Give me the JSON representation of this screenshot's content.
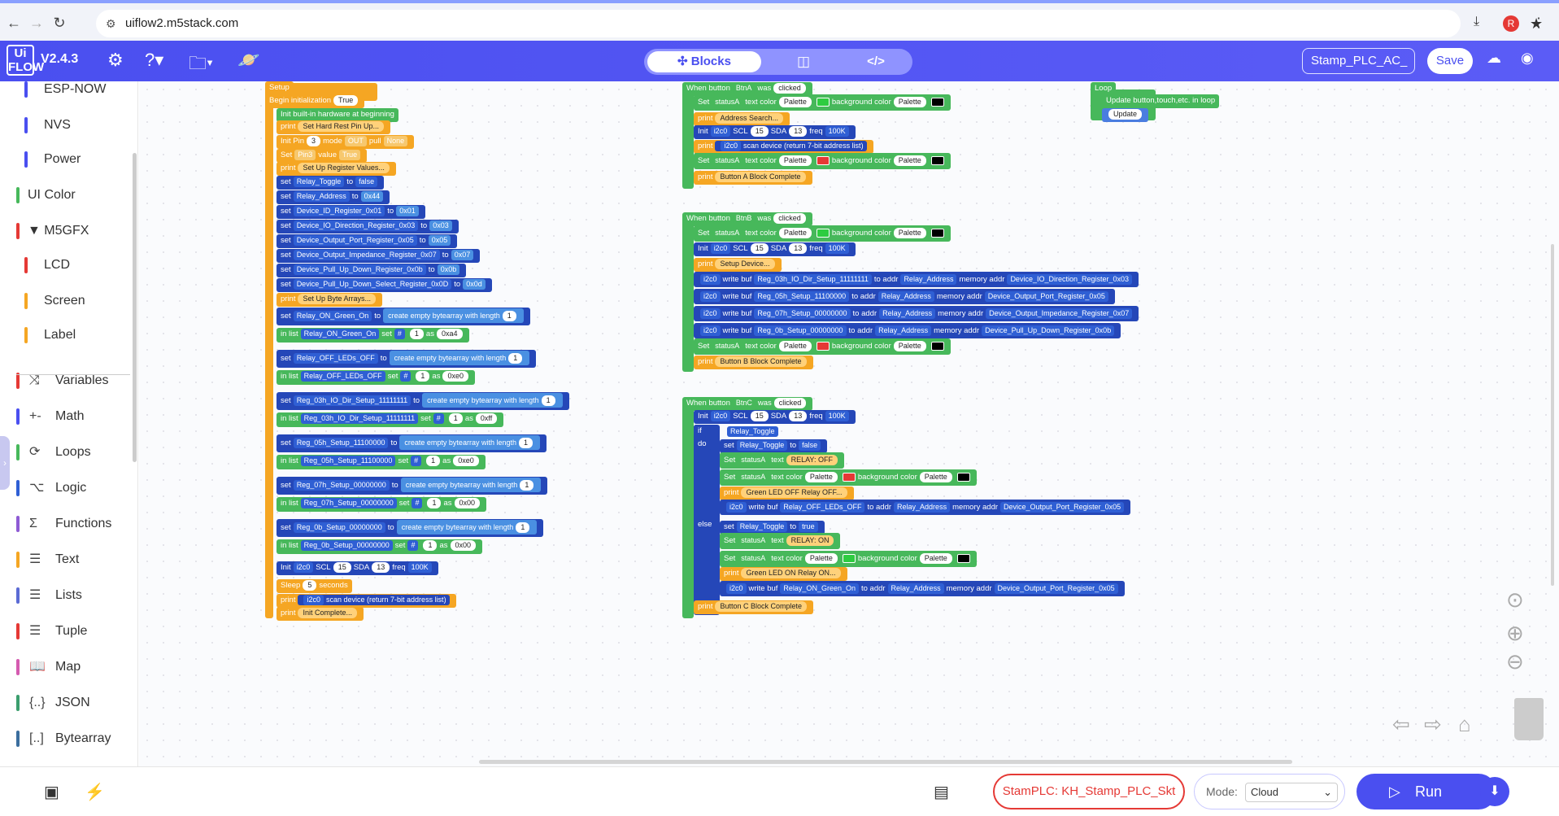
{
  "browser": {
    "url": "uiflow2.m5stack.com",
    "avatar": "R"
  },
  "app": {
    "logo": "Ui FLOW",
    "version": "V2.4.3",
    "tabs": {
      "blocks": "Blocks"
    },
    "project_name": "Stamp_PLC_AC_",
    "save": "Save"
  },
  "sidebar": [
    {
      "label": "ESP-NOW",
      "color": "#4a4ff0"
    },
    {
      "label": "NVS",
      "color": "#4a4ff0"
    },
    {
      "label": "Power",
      "color": "#4a4ff0"
    },
    {
      "label": "UI Color",
      "color": "#47b85b"
    },
    {
      "label": "▼ M5GFX",
      "color": "#e53935"
    },
    {
      "label": "LCD",
      "color": "#e53935"
    },
    {
      "label": "Screen",
      "color": "#f5a623"
    },
    {
      "label": "Label",
      "color": "#f5a623"
    },
    {
      "label": "Variables",
      "color": "#e53935",
      "icon": "⤨"
    },
    {
      "label": "Math",
      "color": "#4a4ff0",
      "icon": "+-"
    },
    {
      "label": "Loops",
      "color": "#47b85b",
      "icon": "⟳"
    },
    {
      "label": "Logic",
      "color": "#2f5fd4",
      "icon": "⌥"
    },
    {
      "label": "Functions",
      "color": "#8e5bd4",
      "icon": "Σ"
    },
    {
      "label": "Text",
      "color": "#f5a623",
      "icon": "☰"
    },
    {
      "label": "Lists",
      "color": "#5b6bd4",
      "icon": "☰"
    },
    {
      "label": "Tuple",
      "color": "#e53935",
      "icon": "☰"
    },
    {
      "label": "Map",
      "color": "#d45bb0",
      "icon": "📖"
    },
    {
      "label": "JSON",
      "color": "#3b9e6e",
      "icon": "{..}"
    },
    {
      "label": "Bytearray",
      "color": "#3b6e9e",
      "icon": "[..]"
    }
  ],
  "footer": {
    "device": "StamPLC: KH_Stamp_PLC_Skt",
    "mode_label": "Mode:",
    "mode_value": "Cloud",
    "run": "Run"
  },
  "blocks": {
    "setup": {
      "title": "Setup",
      "begin": "Begin initialization",
      "true": "True",
      "init_hw": "Init built-in hardware at beginning",
      "print": "print",
      "set": "set",
      "set_cap": "Set",
      "to": "to",
      "init": "Init",
      "in_list": "in list",
      "as": "as",
      "hash": "#",
      "one": "1",
      "create": "create empty bytearray with length",
      "p1": "Set Hard Rest Pin Up...",
      "pin": "Init Pin",
      "pin_num": "3",
      "mode": "mode",
      "mode_val": "OUT",
      "pull": "pull",
      "pull_val": "None",
      "set_pin": "Pin3",
      "value": "value",
      "true_val": "True",
      "p2": "Set Up Register Values...",
      "vars": [
        {
          "name": "Relay_Toggle",
          "val": "false",
          "kind": "bool"
        },
        {
          "name": "Relay_Address",
          "val": "0x44",
          "kind": "num"
        },
        {
          "name": "Device_ID_Register_0x01",
          "val": "0x01",
          "kind": "num"
        },
        {
          "name": "Device_IO_Direction_Register_0x03",
          "val": "0x03",
          "kind": "num"
        },
        {
          "name": "Device_Output_Port_Register_0x05",
          "val": "0x05",
          "kind": "num"
        },
        {
          "name": "Device_Output_Impedance_Register_0x07",
          "val": "0x07",
          "kind": "num"
        },
        {
          "name": "Device_Pull_Up_Down_Register_0x0b",
          "val": "0x0b",
          "kind": "num"
        },
        {
          "name": "Device_Pull_Up_Down_Select_Register_0x0D",
          "val": "0x0d",
          "kind": "num"
        }
      ],
      "p3": "Set Up Byte Arrays...",
      "arrays": [
        {
          "name": "Relay_ON_Green_On",
          "val": "0xa4"
        },
        {
          "name": "Relay_OFF_LEDs_OFF",
          "val": "0xe0"
        },
        {
          "name": "Reg_03h_IO_Dir_Setup_11111111",
          "val": "0xff"
        },
        {
          "name": "Reg_05h_Setup_11100000",
          "val": "0xe0"
        },
        {
          "name": "Reg_07h_Setup_00000000",
          "val": "0x00"
        },
        {
          "name": "Reg_0b_Setup_00000000",
          "val": "0x00"
        }
      ],
      "i2c": "i2c0",
      "scl": "SCL",
      "scl_v": "15",
      "sda": "SDA",
      "sda_v": "13",
      "freq": "freq",
      "freq_v": "100K",
      "sleep": "Sleep",
      "sleep_v": "5",
      "seconds": "seconds",
      "scan": "scan device (return 7-bit address list)",
      "p4": "Init Complete..."
    },
    "btnA": {
      "when": "When button",
      "btn": "BtnA",
      "was": "was",
      "clicked": "clicked",
      "statusA": "statusA",
      "text_color": "text color",
      "palette": "Palette",
      "bg": "background color",
      "addr_search": "Address Search...",
      "complete": "Button A Block Complete"
    },
    "btnB": {
      "btn": "BtnB",
      "setup_dev": "Setup Device...",
      "write_buf": "write buf",
      "to_addr": "to addr",
      "memory_addr": "memory addr",
      "complete": "Button B Block Complete",
      "writes": [
        {
          "buf": "Reg_03h_IO_Dir_Setup_11111111",
          "reg": "Device_IO_Direction_Register_0x03"
        },
        {
          "buf": "Reg_05h_Setup_11100000",
          "reg": "Device_Output_Port_Register_0x05"
        },
        {
          "buf": "Reg_07h_Setup_00000000",
          "reg": "Device_Output_Impedance_Register_0x07"
        },
        {
          "buf": "Reg_0b_Setup_00000000",
          "reg": "Device_Pull_Up_Down_Register_0x0b"
        }
      ]
    },
    "btnC": {
      "btn": "BtnC",
      "if": "if",
      "do": "do",
      "else": "else",
      "text": "text",
      "relay_off": "RELAY: OFF",
      "relay_on": "RELAY: ON",
      "true_v": "true",
      "false_v": "false",
      "led_off": "Green LED OFF Relay OFF...",
      "led_on": "Green LED ON Relay ON...",
      "complete": "Button C Block Complete"
    },
    "loop": {
      "title": "Loop",
      "update_all": "Update button,touch,etc. in loop",
      "update": "Update"
    }
  },
  "colors": {
    "green": "#2ecc40",
    "red": "#e53935",
    "black": "#000000"
  }
}
